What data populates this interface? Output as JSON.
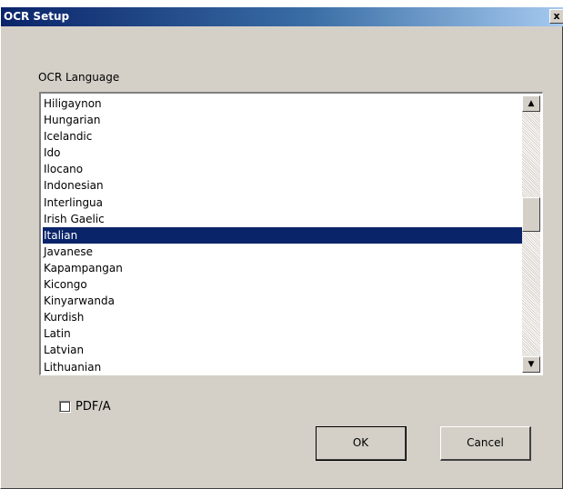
{
  "window": {
    "title": "OCR Setup",
    "close_label": "x"
  },
  "ocr_language": {
    "label": "OCR Language",
    "items": [
      "Hiligaynon",
      "Hungarian",
      "Icelandic",
      "Ido",
      "Ilocano",
      "Indonesian",
      "Interlingua",
      "Irish Gaelic",
      "Italian",
      "Javanese",
      "Kapampangan",
      "Kicongo",
      "Kinyarwanda",
      "Kurdish",
      "Latin",
      "Latvian",
      "Lithuanian"
    ],
    "selected": "Italian",
    "scroll_up_icon": "triangle-up-icon",
    "scroll_down_icon": "triangle-down-icon"
  },
  "pdfa": {
    "label": "PDF/A",
    "checked": false
  },
  "buttons": {
    "ok_label": "OK",
    "cancel_label": "Cancel"
  },
  "colors": {
    "selection": "#0a246a",
    "face": "#d4d0c8"
  }
}
